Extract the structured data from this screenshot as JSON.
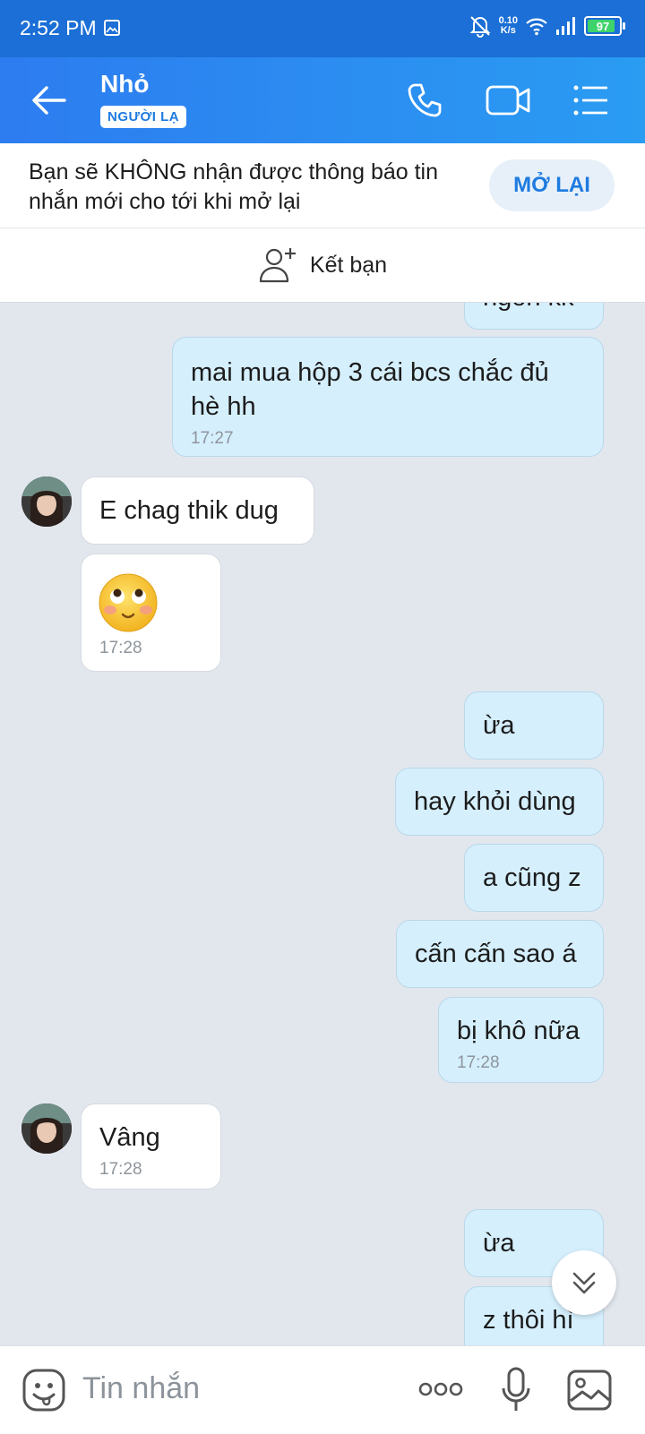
{
  "status_bar": {
    "time": "2:52 PM",
    "net_speed_value": "0.10",
    "net_speed_unit": "K/s",
    "battery": "97"
  },
  "header": {
    "title": "Nhỏ",
    "badge": "NGƯỜI LẠ"
  },
  "notice": {
    "text": "Bạn sẽ KHÔNG nhận được thông báo tin nhắn mới cho tới khi mở lại",
    "button": "MỞ LẠI"
  },
  "add_friend": {
    "label": "Kết bạn"
  },
  "messages": [
    {
      "from": "me",
      "text": "ngon kk"
    },
    {
      "from": "me",
      "text": "mai mua hộp 3 cái bcs chắc đủ hè hh",
      "time": "17:27"
    },
    {
      "from": "them",
      "text": "E chag thik dug"
    },
    {
      "from": "them",
      "emoji": "blushing-face",
      "time": "17:28"
    },
    {
      "from": "me",
      "text": "ừa"
    },
    {
      "from": "me",
      "text": "hay khỏi dùng"
    },
    {
      "from": "me",
      "text": "a cũng z"
    },
    {
      "from": "me",
      "text": "cấn cấn sao á"
    },
    {
      "from": "me",
      "text": "bị khô nữa",
      "time": "17:28"
    },
    {
      "from": "them",
      "text": "Vâng",
      "time": "17:28"
    },
    {
      "from": "me",
      "text": "ừa"
    },
    {
      "from": "me",
      "text": "z thôi hì"
    }
  ],
  "composer": {
    "placeholder": "Tin nhắn"
  },
  "colors": {
    "header": "#2d7cf0",
    "accent": "#1e7be0",
    "my_bubble": "#d5effd",
    "their_bubble": "#ffffff",
    "chat_bg": "#e2e7ee"
  },
  "icons": [
    "back-arrow-icon",
    "phone-icon",
    "video-call-icon",
    "menu-list-icon",
    "add-friend-icon",
    "sticker-icon",
    "more-icon",
    "microphone-icon",
    "image-icon",
    "scroll-down-icon"
  ]
}
